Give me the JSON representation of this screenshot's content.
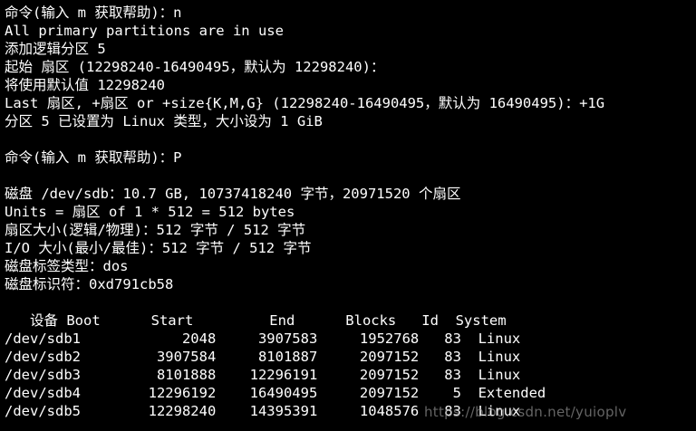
{
  "terminal": {
    "lines": [
      "命令(输入 m 获取帮助)：n",
      "All primary partitions are in use",
      "添加逻辑分区 5",
      "起始 扇区 (12298240-16490495，默认为 12298240)：",
      "将使用默认值 12298240",
      "Last 扇区, +扇区 or +size{K,M,G} (12298240-16490495，默认为 16490495)：+1G",
      "分区 5 已设置为 Linux 类型，大小设为 1 GiB",
      "",
      "命令(输入 m 获取帮助)：P",
      "",
      "磁盘 /dev/sdb：10.7 GB, 10737418240 字节，20971520 个扇区",
      "Units = 扇区 of 1 * 512 = 512 bytes",
      "扇区大小(逻辑/物理)：512 字节 / 512 字节",
      "I/O 大小(最小/最佳)：512 字节 / 512 字节",
      "磁盘标签类型：dos",
      "磁盘标识符：0xd791cb58",
      "",
      "   设备 Boot      Start         End      Blocks   Id  System",
      "/dev/sdb1            2048     3907583     1952768   83  Linux",
      "/dev/sdb2         3907584     8101887     2097152   83  Linux",
      "/dev/sdb3         8101888    12296191     2097152   83  Linux",
      "/dev/sdb4        12296192    16490495     2097152    5  Extended",
      "/dev/sdb5        12298240    14395391     1048576   83  Linux"
    ]
  },
  "watermark": "https://blog.csdn.net/yuioplv"
}
